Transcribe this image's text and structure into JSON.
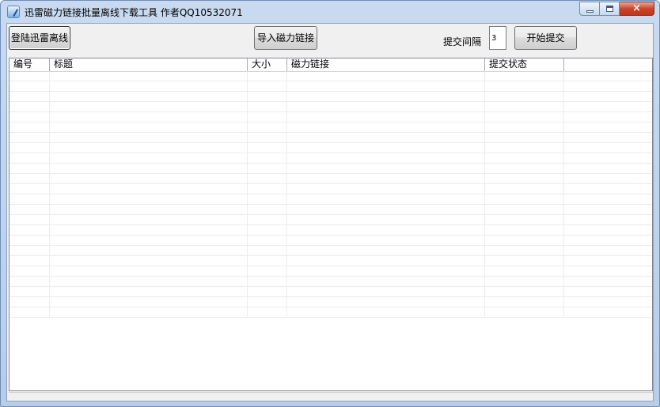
{
  "window": {
    "title": "迅雷磁力链接批量离线下载工具 作者QQ10532071",
    "controls": {
      "close_glyph": "×"
    }
  },
  "toolbar": {
    "login_label": "登陆迅雷离线",
    "import_label": "导入磁力链接",
    "interval_label": "提交间隔",
    "interval_value": "3",
    "start_label": "开始提交"
  },
  "table": {
    "columns": [
      "编号",
      "标题",
      "大小",
      "磁力链接",
      "提交状态",
      ""
    ],
    "rows": []
  },
  "icons": [
    "app-icon",
    "minimize-icon",
    "maximize-icon",
    "close-icon"
  ]
}
